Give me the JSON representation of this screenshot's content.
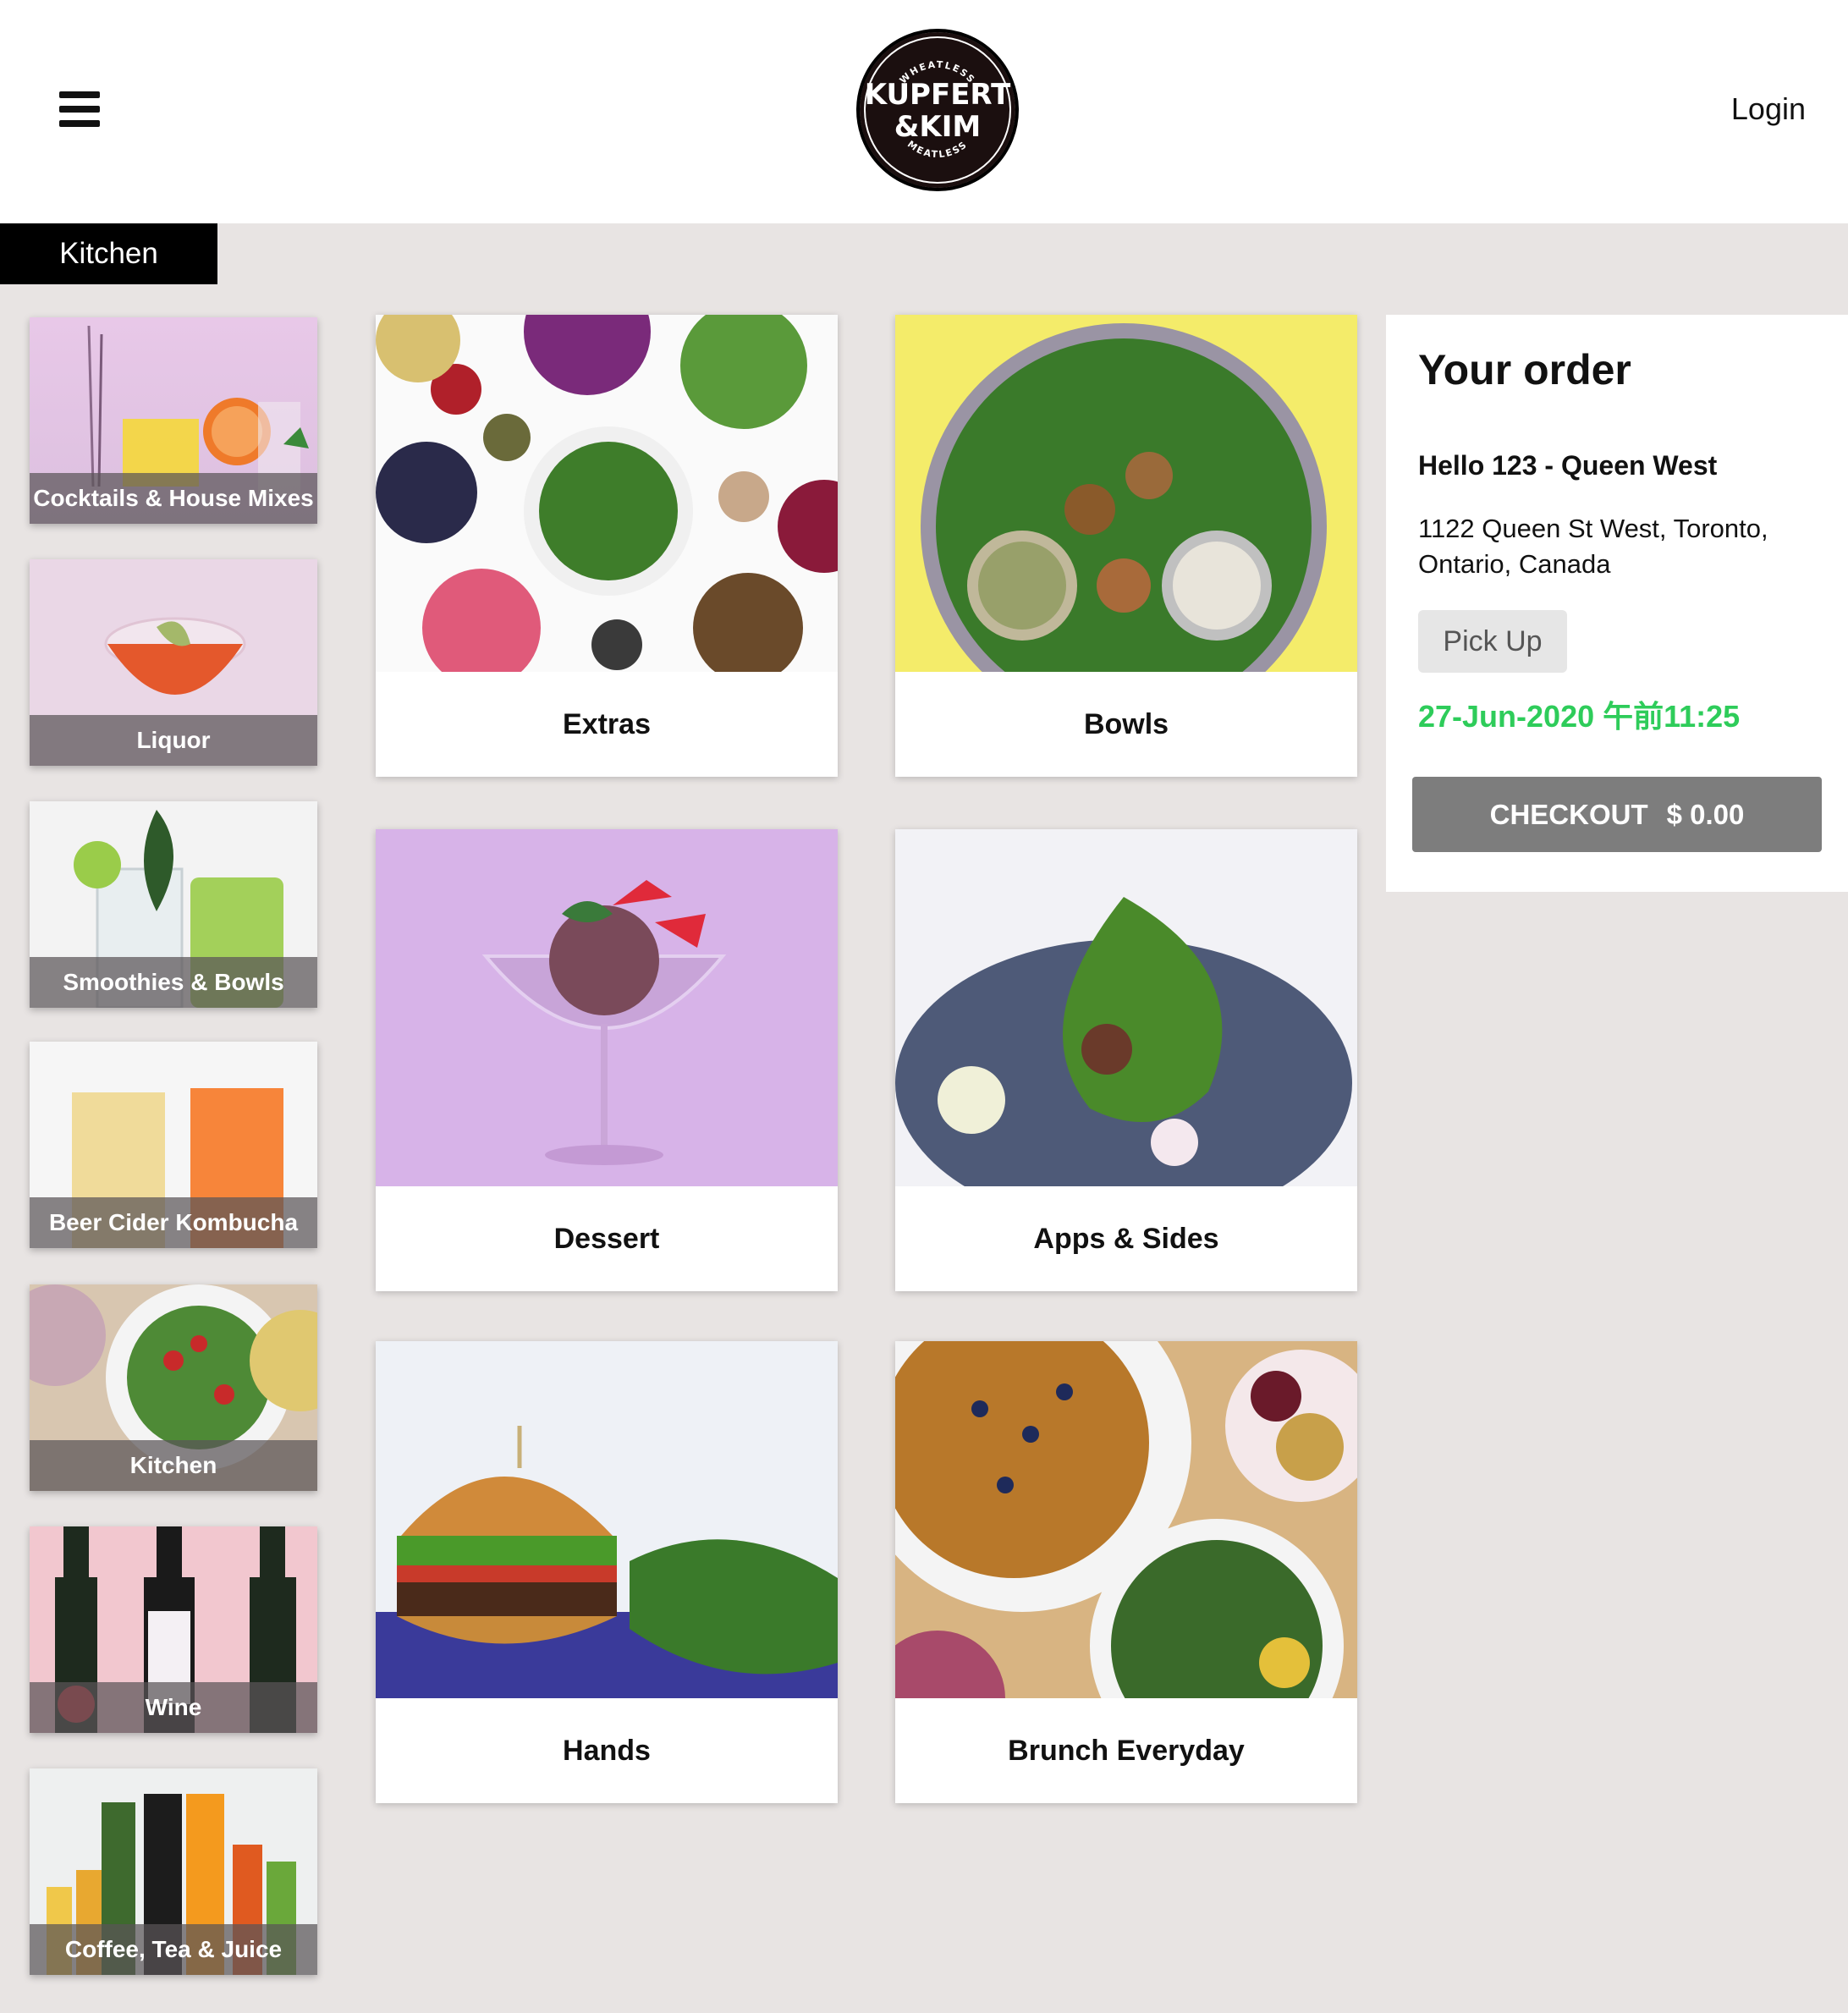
{
  "header": {
    "logo_top": "WHEATLESS",
    "logo_line1": "KUPFERT",
    "logo_line2": "&KIM",
    "logo_bottom": "MEATLESS",
    "login_label": "Login"
  },
  "kitchen_tab": "Kitchen",
  "sidebar": {
    "items": [
      {
        "label": "Cocktails & House Mixes"
      },
      {
        "label": "Liquor"
      },
      {
        "label": "Smoothies & Bowls"
      },
      {
        "label": "Beer Cider Kombucha"
      },
      {
        "label": "Kitchen"
      },
      {
        "label": "Wine"
      },
      {
        "label": "Coffee, Tea & Juice"
      }
    ]
  },
  "categories": [
    {
      "label": "Extras"
    },
    {
      "label": "Bowls"
    },
    {
      "label": "Dessert"
    },
    {
      "label": "Apps & Sides"
    },
    {
      "label": "Hands"
    },
    {
      "label": "Brunch Everyday"
    }
  ],
  "order": {
    "title": "Your order",
    "store": "Hello 123 - Queen West",
    "address": "1122 Queen St West, Toronto, Ontario, Canada",
    "mode": "Pick Up",
    "time": "27-Jun-2020 午前11:25",
    "checkout_label": "CHECKOUT",
    "checkout_amount": "$ 0.00"
  },
  "colors": {
    "background": "#e8e4e3",
    "time_green": "#2ecc5a",
    "checkout_gray": "#7d7d7d"
  }
}
